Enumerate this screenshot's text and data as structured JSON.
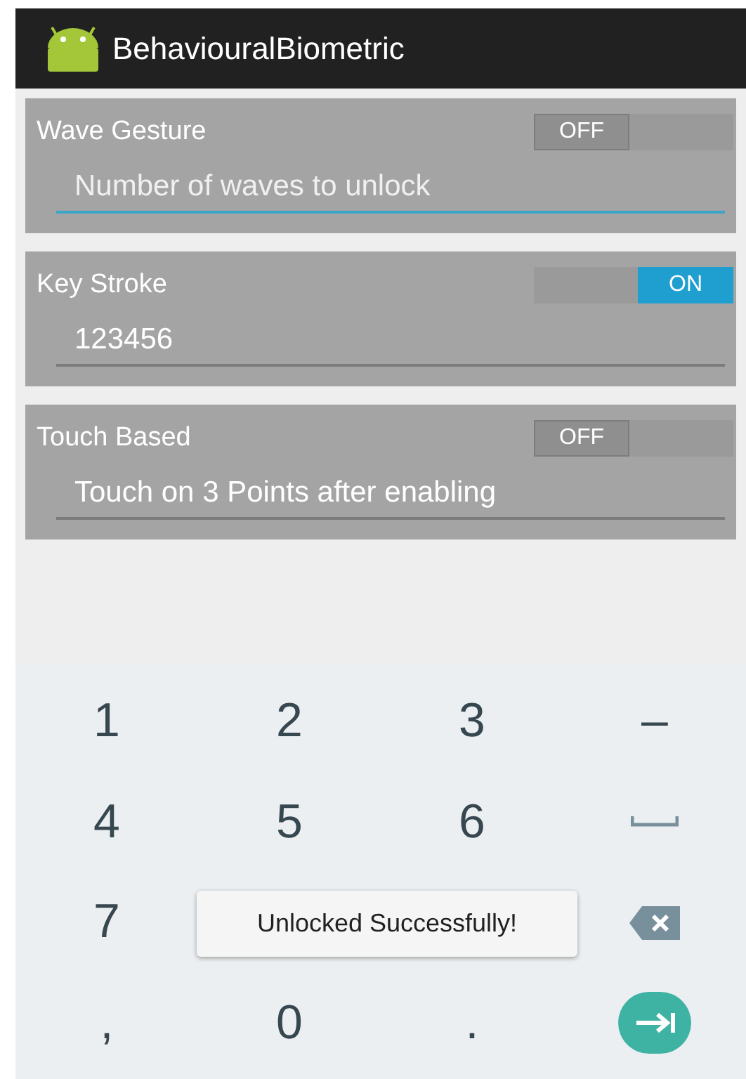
{
  "app_bar": {
    "title": "BehaviouralBiometric"
  },
  "settings": [
    {
      "label": "Wave Gesture",
      "toggle": {
        "on": false,
        "label": "OFF"
      },
      "field": {
        "placeholder": "Number of waves to unlock",
        "focused": true
      }
    },
    {
      "label": "Key Stroke",
      "toggle": {
        "on": true,
        "label": "ON"
      },
      "field": {
        "value": "123456",
        "focused": false
      }
    },
    {
      "label": "Touch Based",
      "toggle": {
        "on": false,
        "label": "OFF"
      },
      "field": {
        "value": "Touch on 3 Points after enabling",
        "focused": false
      }
    }
  ],
  "keyboard": {
    "rows": [
      [
        {
          "kind": "char",
          "label": "1"
        },
        {
          "kind": "char",
          "label": "2"
        },
        {
          "kind": "char",
          "label": "3"
        },
        {
          "kind": "char",
          "label": "–"
        }
      ],
      [
        {
          "kind": "char",
          "label": "4"
        },
        {
          "kind": "char",
          "label": "5"
        },
        {
          "kind": "char",
          "label": "6"
        },
        {
          "kind": "space"
        }
      ],
      [
        {
          "kind": "char",
          "label": "7"
        },
        {
          "kind": "backspace"
        }
      ],
      [
        {
          "kind": "char",
          "label": ","
        },
        {
          "kind": "char",
          "label": "0"
        },
        {
          "kind": "char",
          "label": "."
        },
        {
          "kind": "enter"
        }
      ]
    ]
  },
  "toast": {
    "message": "Unlocked Successfully!"
  }
}
